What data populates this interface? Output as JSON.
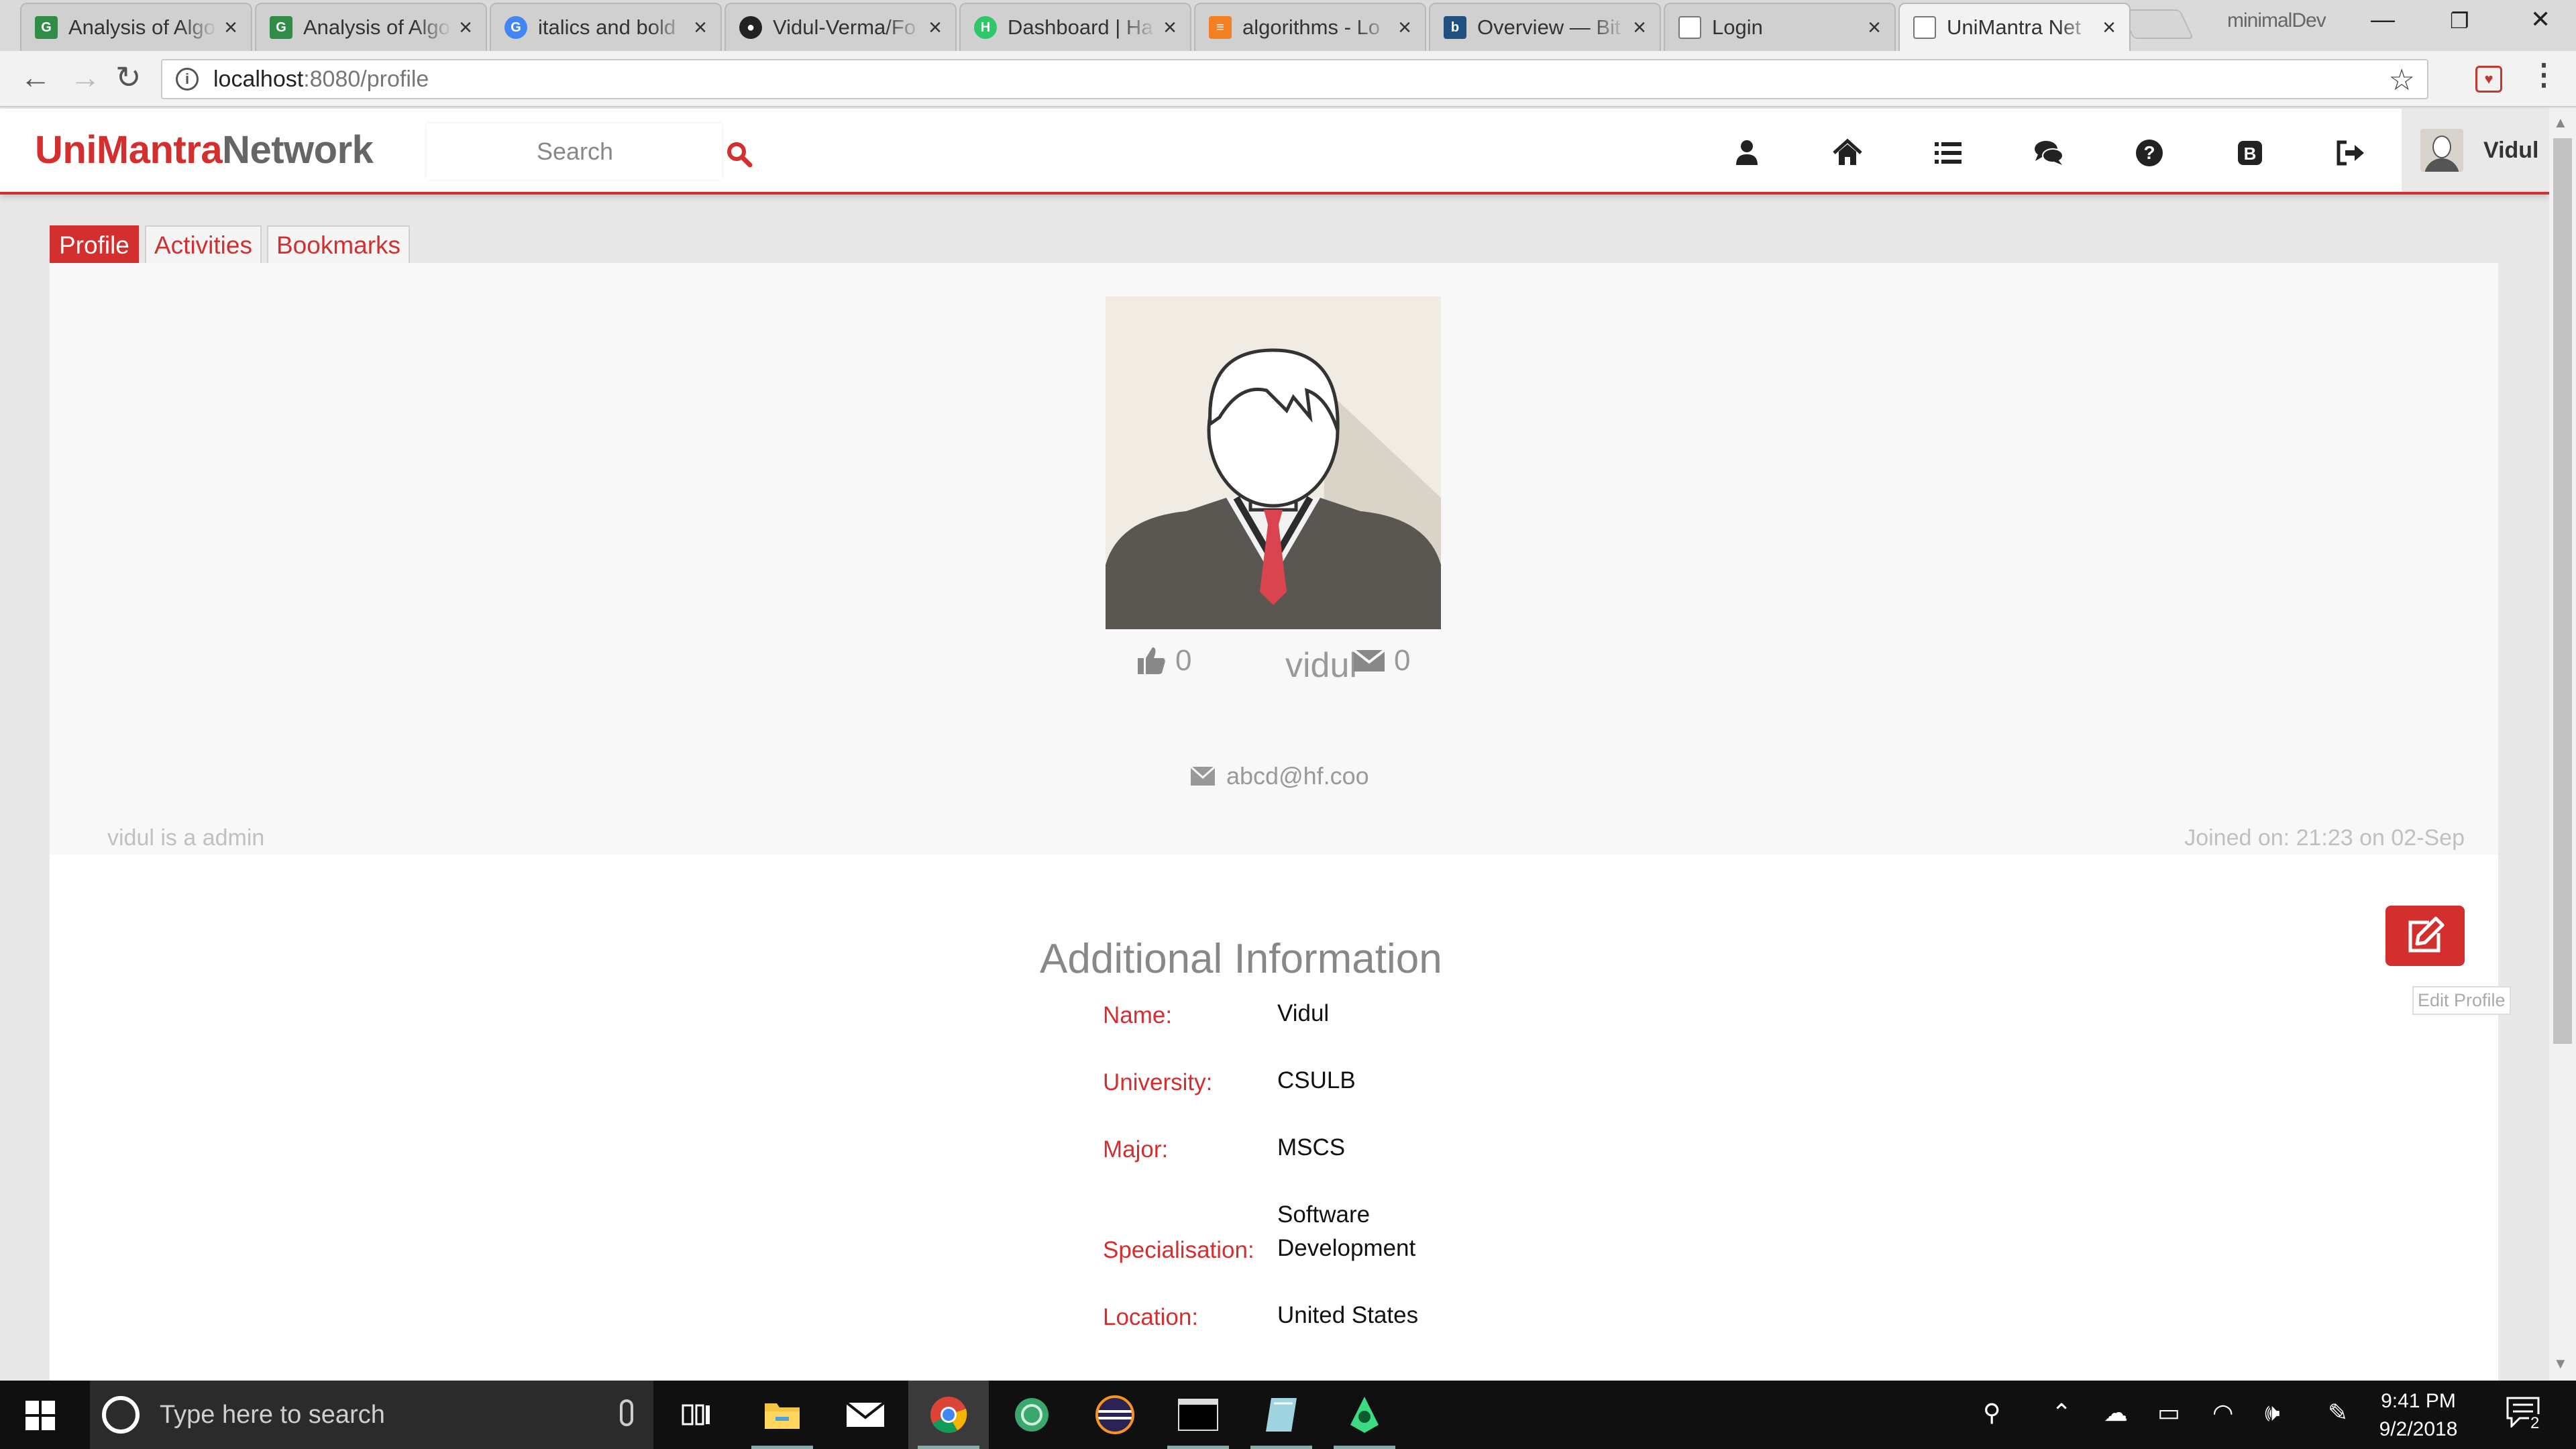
{
  "browser": {
    "tabs": [
      {
        "title": "Analysis of Algo",
        "icon": "gfg-favicon-icon"
      },
      {
        "title": "Analysis of Algo",
        "icon": "gfg-favicon-icon"
      },
      {
        "title": "italics and bold",
        "icon": "google-favicon-icon"
      },
      {
        "title": "Vidul-Verma/Fo",
        "icon": "github-favicon-icon"
      },
      {
        "title": "Dashboard | Ha",
        "icon": "hackerrank-favicon-icon"
      },
      {
        "title": "algorithms - Lo",
        "icon": "stackoverflow-favicon-icon"
      },
      {
        "title": "Overview — Bit",
        "icon": "bitbucket-favicon-icon"
      },
      {
        "title": "Login",
        "icon": "page-icon"
      },
      {
        "title": "UniMantra Net",
        "icon": "page-icon",
        "active": true
      }
    ],
    "profile_name": "minimalDev",
    "url_host": "localhost",
    "url_path": ":8080/profile"
  },
  "site": {
    "logo_part1": "UniMantra",
    "logo_part2": "Network",
    "search_placeholder": "Search",
    "nav_icons": [
      "user-icon",
      "home-icon",
      "list-icon",
      "comments-icon",
      "question-circle-icon",
      "blog-icon",
      "logout-icon"
    ],
    "user_name": "Vidul",
    "accent_color": "#d32f2f"
  },
  "page_tabs": [
    "Profile",
    "Activities",
    "Bookmarks"
  ],
  "profile": {
    "likes": "0",
    "username": "vidul",
    "messages": "0",
    "email": "abcd@hf.coo",
    "role_text": "vidul is a admin",
    "joined_text": "Joined on: 21:23 on 02-Sep"
  },
  "additional_info": {
    "title": "Additional Information",
    "rows": [
      {
        "label": "Name:",
        "value": "Vidul"
      },
      {
        "label": "University:",
        "value": "CSULB"
      },
      {
        "label": "Major:",
        "value": "MSCS"
      },
      {
        "label": "Specialisation:",
        "value": "Software Development"
      },
      {
        "label": "Location:",
        "value": "United States"
      }
    ],
    "edit_tooltip": "Edit Profile"
  },
  "taskbar": {
    "search_placeholder": "Type here to search",
    "time": "9:41 PM",
    "date": "9/2/2018",
    "notification_count": "2"
  }
}
